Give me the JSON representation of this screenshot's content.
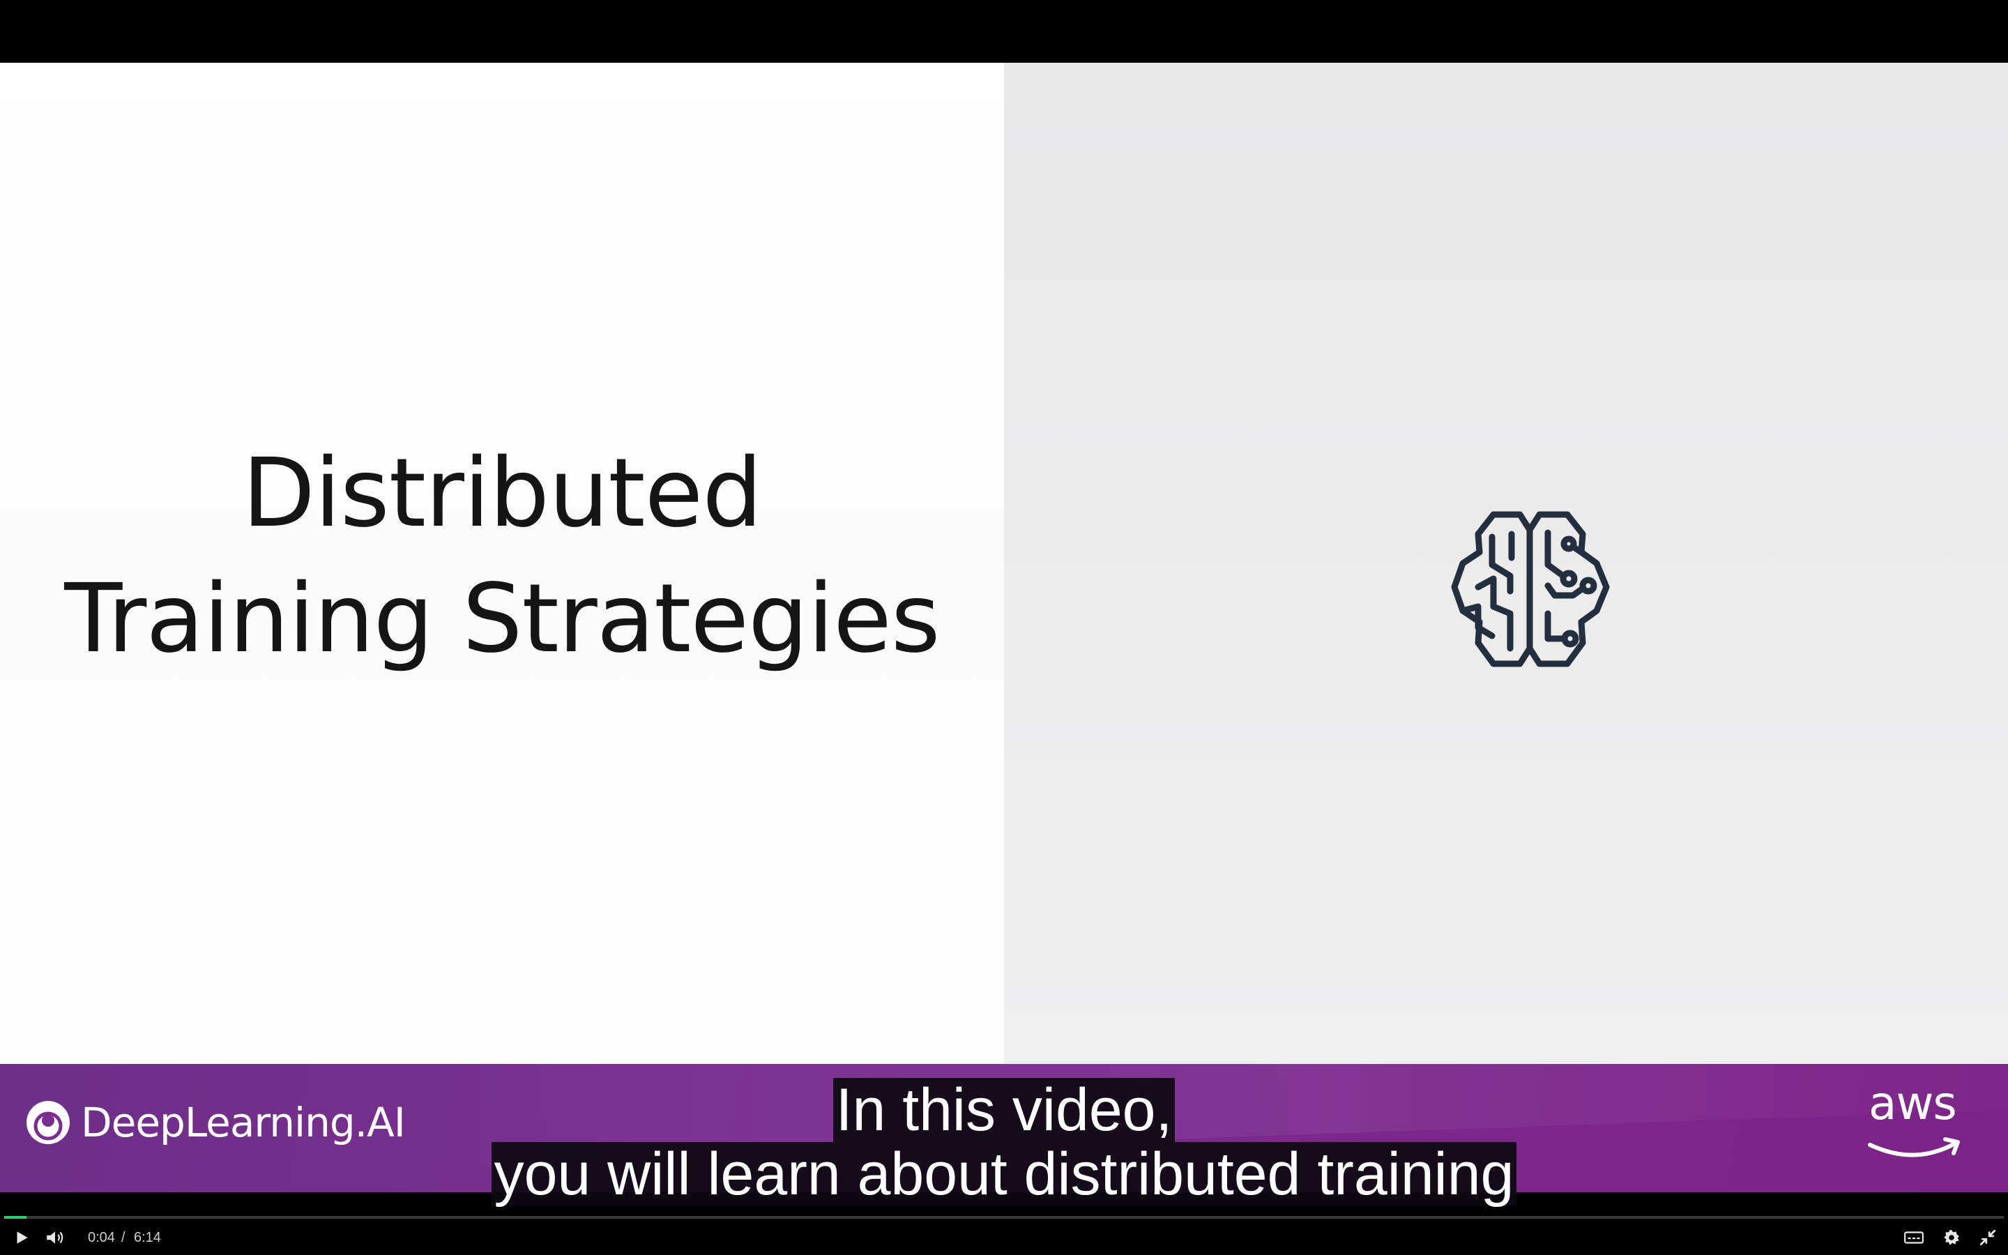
{
  "slide": {
    "title_line1": "Distributed",
    "title_line2": "Training Strategies"
  },
  "footer": {
    "brand_name": "DeepLearning.AI",
    "partner_logo_text": "aws"
  },
  "captions": {
    "line1": "In this video,",
    "line2": "you will learn about distributed training"
  },
  "player": {
    "current_time": "0:04",
    "separator": "/",
    "duration": "6:14",
    "progress_fraction": 0.011,
    "icons": [
      "play-icon",
      "volume-icon",
      "captions-icon",
      "settings-icon",
      "exit-fullscreen-icon"
    ]
  },
  "colors": {
    "band_purple": "#7a2a8c",
    "progress_green": "#2ecc71",
    "slide_text": "#151515"
  }
}
